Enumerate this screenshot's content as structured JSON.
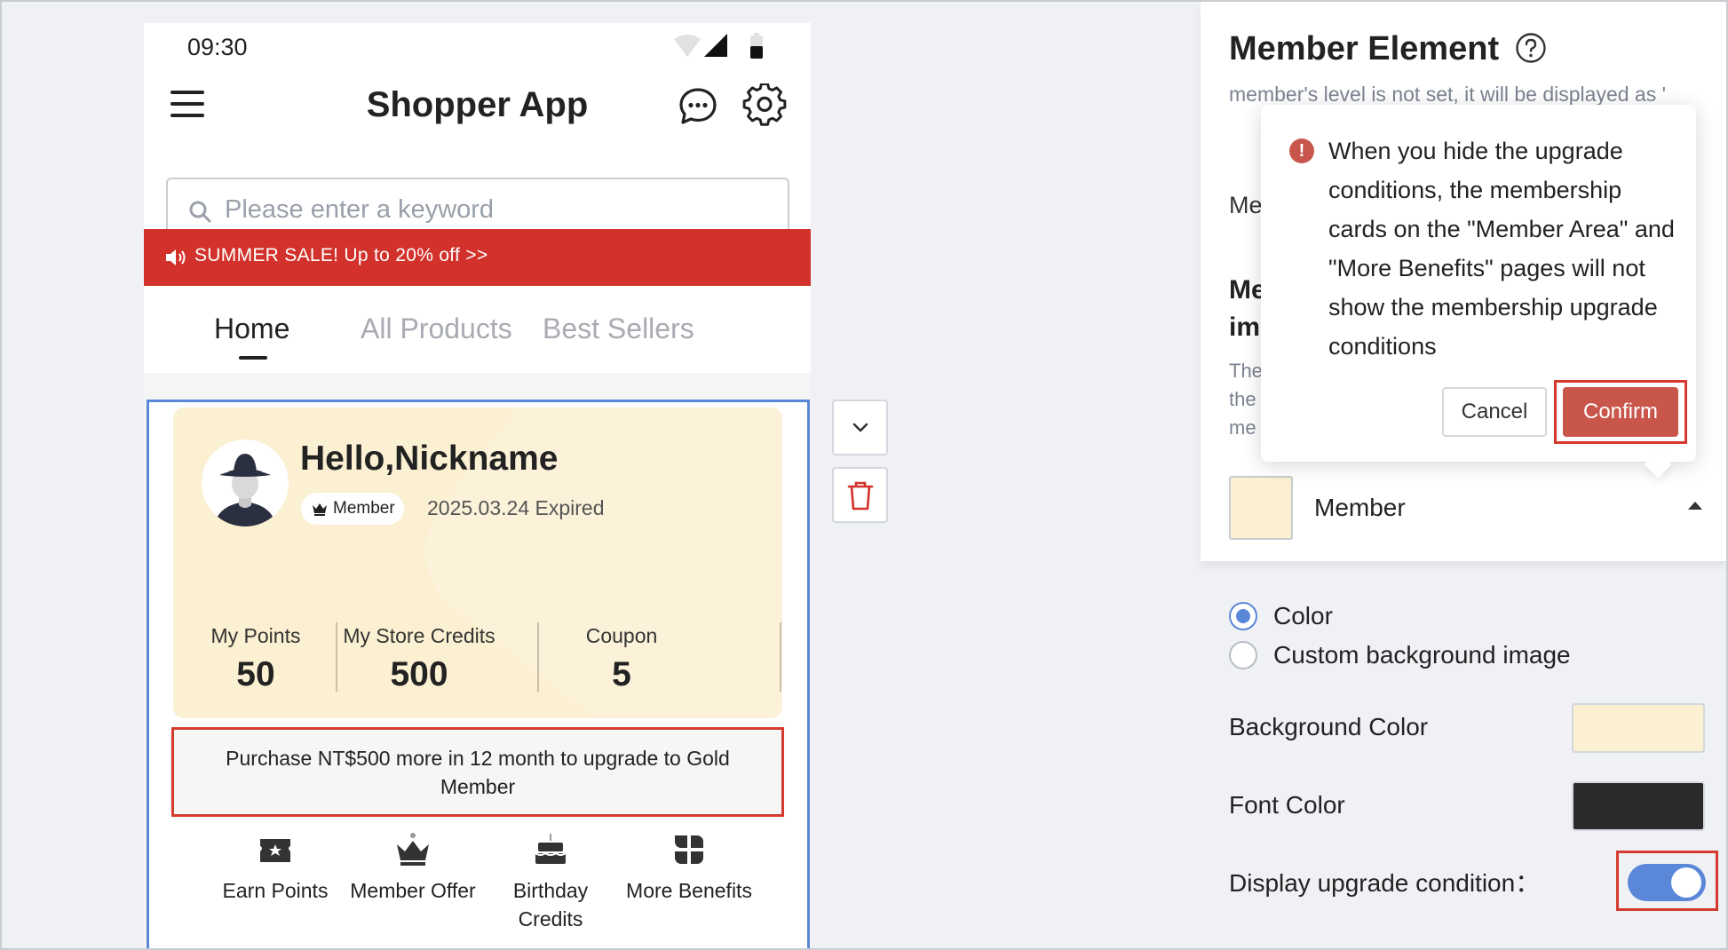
{
  "phone": {
    "status_time": "09:30",
    "app_title": "Shopper App",
    "search": {
      "placeholder": "Please enter a keyword",
      "value": ""
    },
    "sale_banner": "SUMMER SALE! Up to 20% off >>",
    "tabs": [
      {
        "label": "Home",
        "active": true
      },
      {
        "label": "All Products",
        "active": false
      },
      {
        "label": "Best Sellers",
        "active": false
      }
    ],
    "member_card": {
      "greeting": "Hello,Nickname",
      "badge": "Member",
      "expiry": "2025.03.24 Expired",
      "stats": [
        {
          "label": "My Points",
          "value": "50"
        },
        {
          "label": "My Store Credits",
          "value": "500"
        },
        {
          "label": "Coupon",
          "value": "5"
        }
      ],
      "upgrade_text": "Purchase NT$500 more in 12 month to upgrade to Gold Member",
      "quick_links": [
        {
          "label": "Earn Points",
          "icon": "ticket-star-icon"
        },
        {
          "label": "Member Offer",
          "icon": "crown-icon"
        },
        {
          "label": "Birthday Credits",
          "icon": "cake-icon"
        },
        {
          "label": "More Benefits",
          "icon": "grid-icon"
        }
      ]
    }
  },
  "panel": {
    "title": "Member Element",
    "description": "member's level is not set, it will be displayed as '",
    "member_level_label": "Me",
    "section_title": "Me im",
    "section_desc": "The the me",
    "level_name": "Member",
    "background_options": [
      {
        "label": "Color",
        "checked": true
      },
      {
        "label": "Custom background image",
        "checked": false
      }
    ],
    "background_color_label": "Background Color",
    "background_color": "#fcf0d2",
    "font_color_label": "Font Color",
    "font_color": "#2a2a2a",
    "display_upgrade_label": "Display upgrade condition：",
    "display_upgrade_on": true
  },
  "popconfirm": {
    "message": "When you hide the upgrade conditions, the membership cards on the \"Member Area\" and \"More Benefits\" pages will not show the membership upgrade conditions",
    "cancel_label": "Cancel",
    "confirm_label": "Confirm"
  },
  "colors": {
    "accent": "#5b87d8",
    "sale_red": "#d2322b",
    "confirm": "#c8564b",
    "highlight_border": "#d43b2e"
  }
}
